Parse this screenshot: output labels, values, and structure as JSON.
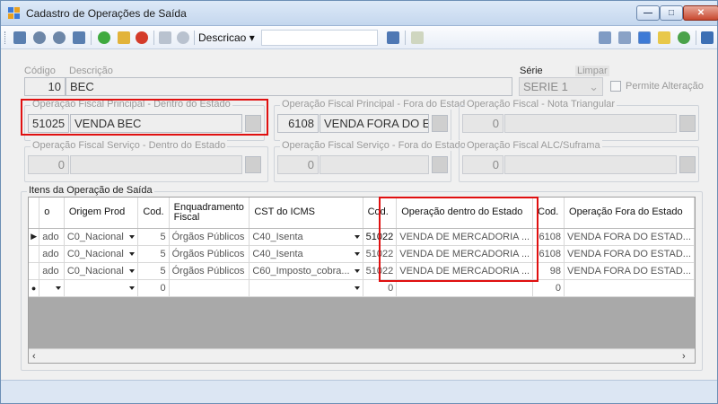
{
  "window": {
    "title": "Cadastro de Operações de Saída"
  },
  "toolbar": {
    "search_field_label": "Descricao",
    "search_value": ""
  },
  "form": {
    "codigo_label": "Código",
    "descricao_label": "Descrição",
    "codigo_value": "10",
    "descricao_value": "BEC",
    "serie_label": "Série",
    "limpar_label": "Limpar",
    "serie_value": "SERIE 1",
    "permite_alteracao_label": "Permite Alteração"
  },
  "groups": {
    "principal_dentro": {
      "caption": "Operação Fiscal Principal - Dentro do Estado",
      "code": "51025",
      "desc": "VENDA BEC"
    },
    "principal_fora": {
      "caption": "Operação Fiscal Principal - Fora do Estado",
      "code": "6108",
      "desc": "VENDA FORA DO ES"
    },
    "nota_triangular": {
      "caption": "Operação Fiscal - Nota Triangular",
      "code": "0",
      "desc": ""
    },
    "servico_dentro": {
      "caption": "Operação Fiscal Serviço - Dentro do Estado",
      "code": "0",
      "desc": ""
    },
    "servico_fora": {
      "caption": "Operação Fiscal Serviço - Fora do Estado",
      "code": "0",
      "desc": ""
    },
    "alc_suframa": {
      "caption": "Operação Fiscal ALC/Suframa",
      "code": "0",
      "desc": ""
    }
  },
  "itens": {
    "caption": "Itens da Operação de Saída",
    "columns": [
      "o",
      "Origem Prod",
      "Cod.",
      "Enquadramento Fiscal",
      "CST do ICMS",
      "Cod.",
      "Operação dentro do Estado",
      "Cod.",
      "Operação Fora do Estado"
    ],
    "rows": [
      {
        "marker": "▶",
        "c0": "ado",
        "c1": "C0_Nacional",
        "c2": "5",
        "c3": "Órgãos Públicos",
        "c4": "C40_Isenta",
        "c5": "51022",
        "c6": "VENDA DE MERCADORIA ...",
        "c7": "6108",
        "c8": "VENDA FORA DO ESTAD..."
      },
      {
        "marker": "",
        "c0": "ado",
        "c1": "C0_Nacional",
        "c2": "5",
        "c3": "Órgãos Públicos",
        "c4": "C40_Isenta",
        "c5": "51022",
        "c6": "VENDA DE MERCADORIA ...",
        "c7": "6108",
        "c8": "VENDA FORA DO ESTAD..."
      },
      {
        "marker": "",
        "c0": "ado",
        "c1": "C0_Nacional",
        "c2": "5",
        "c3": "Órgãos Públicos",
        "c4": "C60_Imposto_cobra...",
        "c5": "51022",
        "c6": "VENDA DE MERCADORIA ...",
        "c7": "98",
        "c8": "VENDA FORA DO ESTAD..."
      },
      {
        "marker": "●",
        "c0": "",
        "c1": "",
        "c2": "0",
        "c3": "",
        "c4": "",
        "c5": "0",
        "c6": "",
        "c7": "0",
        "c8": ""
      }
    ]
  },
  "colors": {
    "highlight": "#e01010",
    "title_gradient_top": "#dde9f7",
    "close_button": "#c8482f"
  }
}
